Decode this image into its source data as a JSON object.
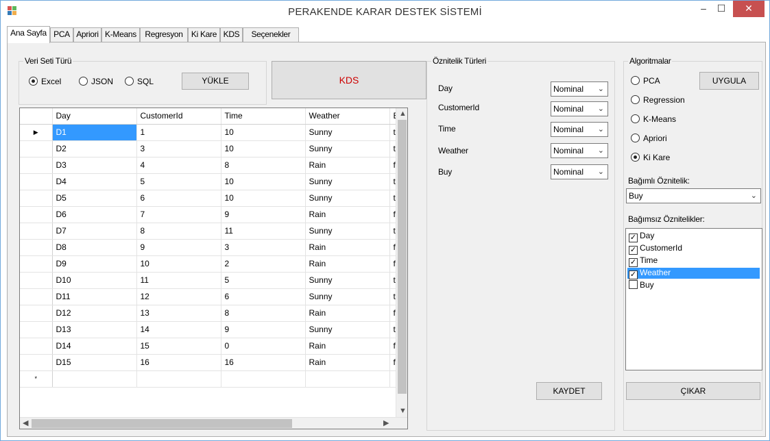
{
  "window": {
    "title": "PERAKENDE KARAR DESTEK SİSTEMİ",
    "min": "–",
    "max": "☐",
    "close": "✕"
  },
  "tabs": [
    "Ana Sayfa",
    "PCA",
    "Apriori",
    "K-Means",
    "Regresyon",
    "Ki Kare",
    "KDS",
    "Seçenekler"
  ],
  "dataset": {
    "group_title": "Veri Seti Türü",
    "options": [
      "Excel",
      "JSON",
      "SQL"
    ],
    "selected": "Excel",
    "load_button": "YÜKLE"
  },
  "kds_button": "KDS",
  "grid": {
    "columns": [
      "Day",
      "CustomerId",
      "Time",
      "Weather",
      "B"
    ],
    "rows": [
      [
        "D1",
        "1",
        "10",
        "Sunny",
        "tru"
      ],
      [
        "D2",
        "3",
        "10",
        "Sunny",
        "tru"
      ],
      [
        "D3",
        "4",
        "8",
        "Rain",
        "fal"
      ],
      [
        "D4",
        "5",
        "10",
        "Sunny",
        "tru"
      ],
      [
        "D5",
        "6",
        "10",
        "Sunny",
        "tru"
      ],
      [
        "D6",
        "7",
        "9",
        "Rain",
        "fal"
      ],
      [
        "D7",
        "8",
        "11",
        "Sunny",
        "tru"
      ],
      [
        "D8",
        "9",
        "3",
        "Rain",
        "fal"
      ],
      [
        "D9",
        "10",
        "2",
        "Rain",
        "fal"
      ],
      [
        "D10",
        "11",
        "5",
        "Sunny",
        "tru"
      ],
      [
        "D11",
        "12",
        "6",
        "Sunny",
        "tru"
      ],
      [
        "D12",
        "13",
        "8",
        "Rain",
        "fal"
      ],
      [
        "D13",
        "14",
        "9",
        "Sunny",
        "tru"
      ],
      [
        "D14",
        "15",
        "0",
        "Rain",
        "fal"
      ],
      [
        "D15",
        "16",
        "16",
        "Rain",
        "fal"
      ]
    ],
    "current_row_marker": "▶",
    "new_row_marker": "*"
  },
  "attributes": {
    "group_title": "Öznitelik Türleri",
    "items": [
      {
        "name": "Day",
        "type": "Nominal"
      },
      {
        "name": "CustomerId",
        "type": "Nominal"
      },
      {
        "name": "Time",
        "type": "Nominal"
      },
      {
        "name": "Weather",
        "type": "Nominal"
      },
      {
        "name": "Buy",
        "type": "Nominal"
      }
    ],
    "save_button": "KAYDET"
  },
  "algorithms": {
    "group_title": "Algoritmalar",
    "options": [
      "PCA",
      "Regression",
      "K-Means",
      "Apriori",
      "Ki Kare"
    ],
    "selected": "Ki Kare",
    "apply_button": "UYGULA",
    "dependent_label": "Bağımlı Öznitelik:",
    "dependent_value": "Buy",
    "independent_label": "Bağımsız Öznitelikler:",
    "independent_items": [
      {
        "label": "Day",
        "checked": true
      },
      {
        "label": "CustomerId",
        "checked": true
      },
      {
        "label": "Time",
        "checked": true
      },
      {
        "label": "Weather",
        "checked": true,
        "selected": true
      },
      {
        "label": "Buy",
        "checked": false
      }
    ],
    "extract_button": "ÇIKAR"
  },
  "icons": {
    "checkmark": "✓",
    "dropdown": "⌄"
  }
}
